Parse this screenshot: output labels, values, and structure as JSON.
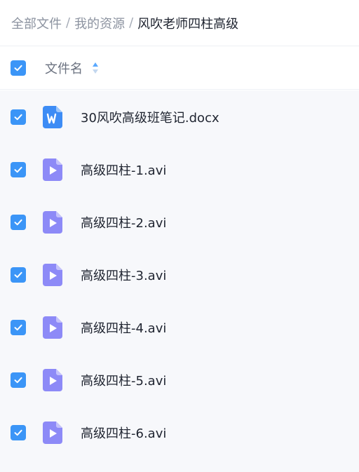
{
  "breadcrumb": {
    "items": [
      "全部文件",
      "我的资源"
    ],
    "separator": "/",
    "current": "风吹老师四柱高级"
  },
  "list_header": {
    "column_label": "文件名",
    "select_all_checked": true
  },
  "files": [
    {
      "name": "30风吹高级班笔记.docx",
      "type": "word-doc",
      "checked": true
    },
    {
      "name": "高级四柱-1.avi",
      "type": "video",
      "checked": true
    },
    {
      "name": "高级四柱-2.avi",
      "type": "video",
      "checked": true
    },
    {
      "name": "高级四柱-3.avi",
      "type": "video",
      "checked": true
    },
    {
      "name": "高级四柱-4.avi",
      "type": "video",
      "checked": true
    },
    {
      "name": "高级四柱-5.avi",
      "type": "video",
      "checked": true
    },
    {
      "name": "高级四柱-6.avi",
      "type": "video",
      "checked": true
    }
  ],
  "colors": {
    "checkbox": "#3b95f7",
    "word_icon": "#3d8cf5",
    "video_icon": "#8d8af7"
  }
}
